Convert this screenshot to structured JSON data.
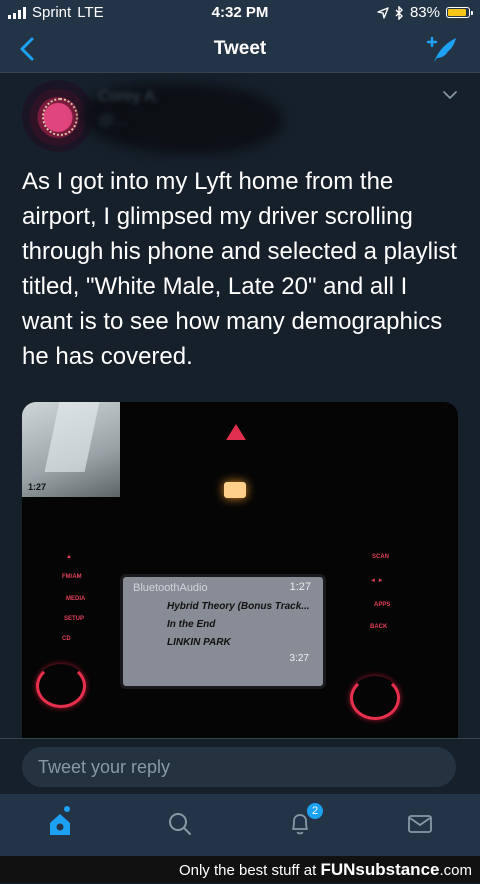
{
  "status_bar": {
    "carrier": "Sprint",
    "network": "LTE",
    "time": "4:32 PM",
    "battery": "83%",
    "battery_level": 0.83
  },
  "nav": {
    "title": "Tweet"
  },
  "author": {
    "name": "Corey A.",
    "handle": "@..."
  },
  "tweet": {
    "text": "As I got into my Lyft home from the airport, I glimpsed my driver scrolling through his phone and selected a playlist titled, \"White Male, Late 20\" and all I want is to see how many demographics he has covered."
  },
  "media": {
    "source": "BluetoothAudio",
    "clock": "1:27",
    "album": "Hybrid Theory (Bonus Track...",
    "song": "In the End",
    "artist": "LINKIN PARK",
    "duration": "3:27",
    "phone_time": "1:27"
  },
  "reply": {
    "placeholder": "Tweet your reply"
  },
  "tabs": {
    "notifications_badge": "2"
  },
  "watermark": {
    "prefix": "Only the best stuff at",
    "brand": "FUNsubstance",
    "suffix": ".com"
  },
  "colors": {
    "background": "#15202b",
    "bar": "#243447",
    "accent": "#1da1f2"
  }
}
